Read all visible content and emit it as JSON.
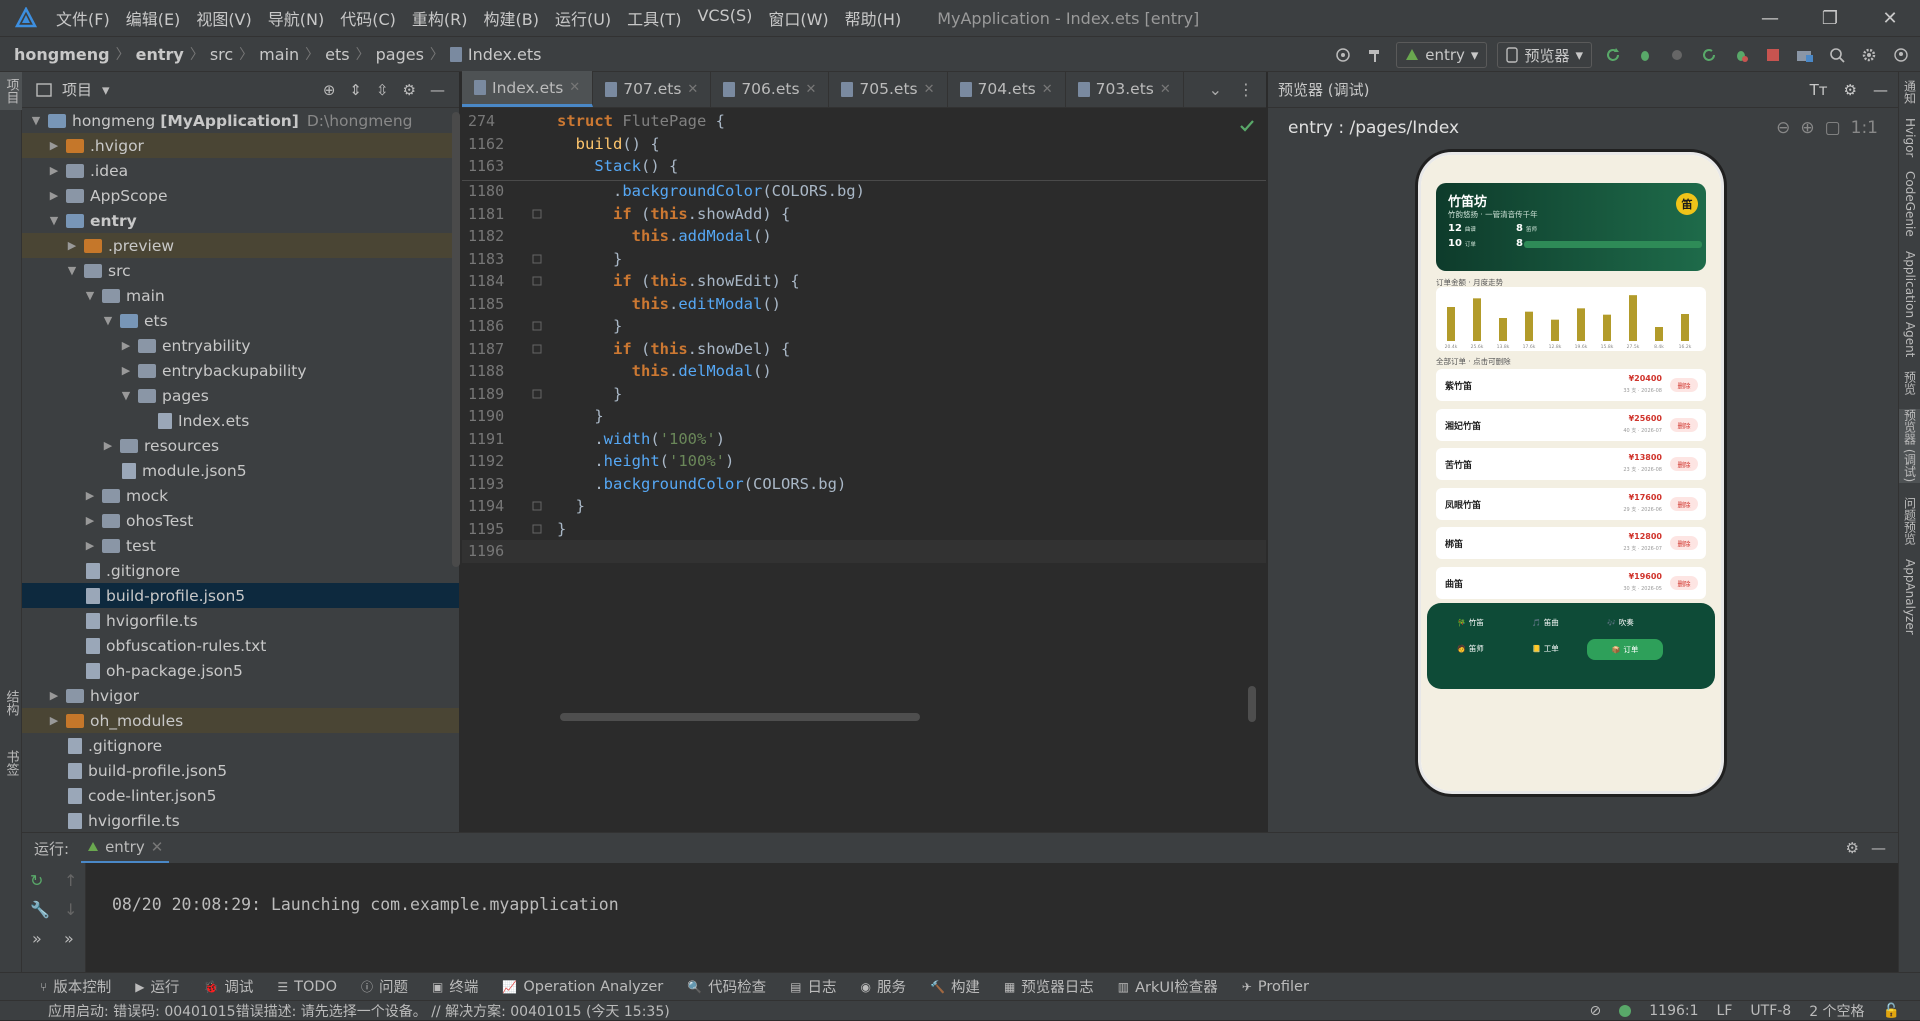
{
  "titlebar": {
    "menu": [
      "文件(F)",
      "编辑(E)",
      "视图(V)",
      "导航(N)",
      "代码(C)",
      "重构(R)",
      "构建(B)",
      "运行(U)",
      "工具(T)",
      "VCS(S)",
      "窗口(W)",
      "帮助(H)"
    ],
    "title": "MyApplication - Index.ets [entry]"
  },
  "breadcrumb": [
    "hongmeng",
    "entry",
    "src",
    "main",
    "ets",
    "pages",
    "Index.ets"
  ],
  "toolbar": {
    "module_select": "entry",
    "device_select": "预览器"
  },
  "project_panel": {
    "title": "项目",
    "tree": [
      {
        "label": "hongmeng",
        "bold": "[MyApplication]",
        "extra": "D:\\hongmeng",
        "depth": 0,
        "arrow": "open",
        "icon": "folder-module"
      },
      {
        "label": ".hvigor",
        "depth": 1,
        "arrow": "closed",
        "icon": "folder-orange",
        "hl": true
      },
      {
        "label": ".idea",
        "depth": 1,
        "arrow": "closed",
        "icon": "folder"
      },
      {
        "label": "AppScope",
        "depth": 1,
        "arrow": "closed",
        "icon": "folder"
      },
      {
        "label": "entry",
        "depth": 1,
        "arrow": "open",
        "icon": "folder-module",
        "bold_label": true
      },
      {
        "label": ".preview",
        "depth": 2,
        "arrow": "closed",
        "icon": "folder-orange",
        "hl": true
      },
      {
        "label": "src",
        "depth": 2,
        "arrow": "open",
        "icon": "folder"
      },
      {
        "label": "main",
        "depth": 3,
        "arrow": "open",
        "icon": "folder"
      },
      {
        "label": "ets",
        "depth": 4,
        "arrow": "open",
        "icon": "folder-module"
      },
      {
        "label": "entryability",
        "depth": 5,
        "arrow": "closed",
        "icon": "folder"
      },
      {
        "label": "entrybackupability",
        "depth": 5,
        "arrow": "closed",
        "icon": "folder"
      },
      {
        "label": "pages",
        "depth": 5,
        "arrow": "open",
        "icon": "folder"
      },
      {
        "label": "Index.ets",
        "depth": 6,
        "arrow": "none",
        "icon": "file"
      },
      {
        "label": "resources",
        "depth": 4,
        "arrow": "closed",
        "icon": "folder"
      },
      {
        "label": "module.json5",
        "depth": 4,
        "arrow": "none",
        "icon": "file"
      },
      {
        "label": "mock",
        "depth": 3,
        "arrow": "closed",
        "icon": "folder"
      },
      {
        "label": "ohosTest",
        "depth": 3,
        "arrow": "closed",
        "icon": "folder"
      },
      {
        "label": "test",
        "depth": 3,
        "arrow": "closed",
        "icon": "folder"
      },
      {
        "label": ".gitignore",
        "depth": 2,
        "arrow": "none",
        "icon": "file"
      },
      {
        "label": "build-profile.json5",
        "depth": 2,
        "arrow": "none",
        "icon": "file",
        "selected": true
      },
      {
        "label": "hvigorfile.ts",
        "depth": 2,
        "arrow": "none",
        "icon": "file"
      },
      {
        "label": "obfuscation-rules.txt",
        "depth": 2,
        "arrow": "none",
        "icon": "file"
      },
      {
        "label": "oh-package.json5",
        "depth": 2,
        "arrow": "none",
        "icon": "file"
      },
      {
        "label": "hvigor",
        "depth": 1,
        "arrow": "closed",
        "icon": "folder"
      },
      {
        "label": "oh_modules",
        "depth": 1,
        "arrow": "closed",
        "icon": "folder-orange",
        "hl": true
      },
      {
        "label": ".gitignore",
        "depth": 1,
        "arrow": "none",
        "icon": "file"
      },
      {
        "label": "build-profile.json5",
        "depth": 1,
        "arrow": "none",
        "icon": "file"
      },
      {
        "label": "code-linter.json5",
        "depth": 1,
        "arrow": "none",
        "icon": "file"
      },
      {
        "label": "hvigorfile.ts",
        "depth": 1,
        "arrow": "none",
        "icon": "file"
      }
    ]
  },
  "editor": {
    "tabs": [
      {
        "label": "Index.ets",
        "active": true
      },
      {
        "label": "707.ets"
      },
      {
        "label": "706.ets"
      },
      {
        "label": "705.ets"
      },
      {
        "label": "704.ets"
      },
      {
        "label": "703.ets"
      }
    ],
    "sticky_lines": [
      {
        "n": "274",
        "html": "<span class=\"kw\">struct</span> <span class=\"gray\">FlutePage</span> {"
      },
      {
        "n": "1162",
        "html": "  <span class=\"fn\">build</span>() {"
      },
      {
        "n": "1163",
        "html": "    <span class=\"mt\">Stack</span>() {"
      }
    ],
    "lines": [
      {
        "n": "1180",
        "html": "      .<span class=\"mt\">backgroundColor</span>(COLORS.bg)"
      },
      {
        "n": "1181",
        "html": "      <span class=\"kw\">if</span> (<span class=\"kw\">this</span>.showAdd) {"
      },
      {
        "n": "1182",
        "html": "        <span class=\"kw\">this</span>.<span class=\"mt\">addModal</span>()"
      },
      {
        "n": "1183",
        "html": "      }"
      },
      {
        "n": "1184",
        "html": "      <span class=\"kw\">if</span> (<span class=\"kw\">this</span>.showEdit) {"
      },
      {
        "n": "1185",
        "html": "        <span class=\"kw\">this</span>.<span class=\"mt\">editModal</span>()"
      },
      {
        "n": "1186",
        "html": "      }"
      },
      {
        "n": "1187",
        "html": "      <span class=\"kw\">if</span> (<span class=\"kw\">this</span>.showDel) {"
      },
      {
        "n": "1188",
        "html": "        <span class=\"kw\">this</span>.<span class=\"mt\">delModal</span>()"
      },
      {
        "n": "1189",
        "html": "      }"
      },
      {
        "n": "1190",
        "html": "    }"
      },
      {
        "n": "1191",
        "html": "    .<span class=\"mt\">width</span>(<span class=\"st\">'100%'</span>)"
      },
      {
        "n": "1192",
        "html": "    .<span class=\"mt\">height</span>(<span class=\"st\">'100%'</span>)"
      },
      {
        "n": "1193",
        "html": "    .<span class=\"mt\">backgroundColor</span>(COLORS.bg)"
      },
      {
        "n": "1194",
        "html": "  }"
      },
      {
        "n": "1195",
        "html": "}"
      },
      {
        "n": "1196",
        "html": ""
      }
    ]
  },
  "previewer": {
    "title": "预览器 (调试)",
    "route": "entry : /pages/Index",
    "app": {
      "brand": "竹笛坊",
      "slogan": "竹韵悠扬 · 一管清音传千年",
      "badge": "笛",
      "stats": [
        {
          "value": "12",
          "label": "曲谱"
        },
        {
          "value": "8",
          "label": "笛师"
        },
        {
          "value": "10",
          "label": "订单"
        },
        {
          "value": "8",
          "label": "工单"
        }
      ],
      "chart_title": "订单金额 · 月度走势",
      "chart_data": {
        "type": "bar",
        "categories": [
          "20.4k",
          "25.6k",
          "13.8k",
          "17.6k",
          "12.8k",
          "19.6k",
          "15.8k",
          "27.5k",
          "8.4k",
          "16.2k"
        ],
        "values": [
          20.4,
          25.6,
          13.8,
          17.6,
          12.8,
          19.6,
          15.8,
          27.5,
          8.4,
          16.2
        ]
      },
      "list_title": "全部订单 · 点击可删除",
      "orders": [
        {
          "name": "紫竹笛",
          "price": "¥20400",
          "date": "33 支 · 2026-08",
          "del": "删除"
        },
        {
          "name": "湘妃竹笛",
          "price": "¥25600",
          "date": "40 支 · 2026-07",
          "del": "删除"
        },
        {
          "name": "苦竹笛",
          "price": "¥13800",
          "date": "23 支 · 2026-08",
          "del": "删除"
        },
        {
          "name": "凤眼竹笛",
          "price": "¥17600",
          "date": "29 支 · 2026-06",
          "del": "删除"
        },
        {
          "name": "梆笛",
          "price": "¥12800",
          "date": "23 支 · 2026-07",
          "del": "删除"
        },
        {
          "name": "曲笛",
          "price": "¥19600",
          "date": "30 支 · 2026-05",
          "del": "删除"
        }
      ],
      "tabbar": [
        {
          "label": "竹笛",
          "icon": "🎋"
        },
        {
          "label": "笛曲",
          "icon": "🎵"
        },
        {
          "label": "吹奏",
          "icon": "🎶"
        },
        {
          "label": "笛师",
          "icon": "🧑"
        },
        {
          "label": "工单",
          "icon": "📒"
        },
        {
          "label": "订单",
          "icon": "📦",
          "active": true
        }
      ]
    }
  },
  "run_panel": {
    "label": "运行:",
    "tab": "entry",
    "log": "08/20 20:08:29: Launching com.example.myapplication"
  },
  "tool_windows": [
    "版本控制",
    "运行",
    "调试",
    "TODO",
    "问题",
    "终端",
    "Operation Analyzer",
    "代码检查",
    "日志",
    "服务",
    "构建",
    "预览器日志",
    "ArkUI检查器",
    "Profiler"
  ],
  "left_strip": [
    "项目",
    "结构",
    "书签"
  ],
  "right_strip": [
    "通知",
    "Hvigor",
    "CodeGenie",
    "Application Agent",
    "预览",
    "预览器 (调试)",
    "问题预览",
    "AppAnalyzer"
  ],
  "statusbar": {
    "message": "应用启动: 错误码: 00401015错误描述: 请先选择一个设备。 // 解决方案: 00401015 (今天 15:35)",
    "position": "1196:1",
    "line_sep": "LF",
    "encoding": "UTF-8",
    "indent": "2 个空格"
  },
  "colors": {
    "accent": "#4a88c7",
    "bar": "#b29b2a",
    "tabbar": "#0e4b37",
    "price": "#d0342c"
  }
}
